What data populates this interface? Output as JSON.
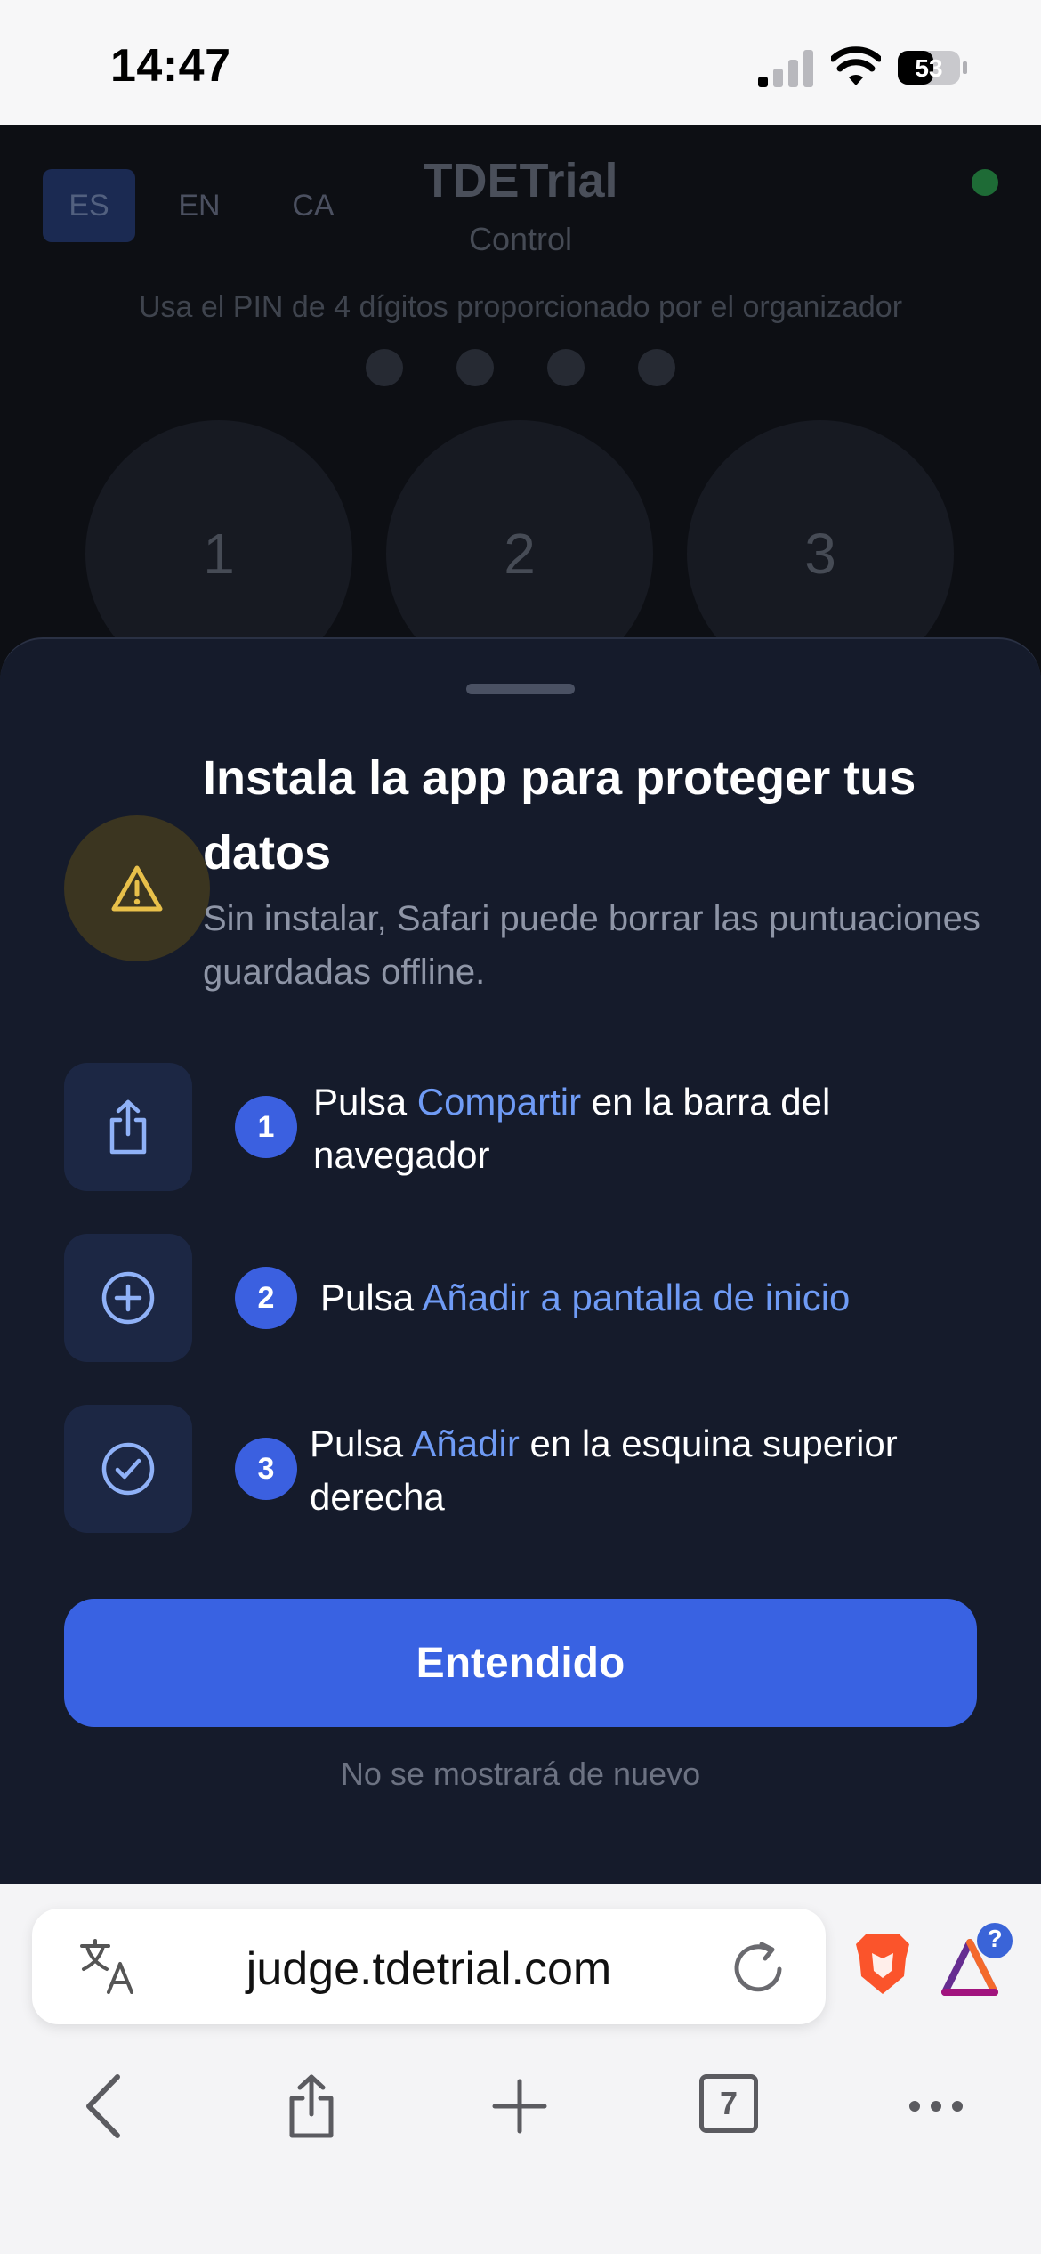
{
  "status_bar": {
    "time": "14:47",
    "battery": "53"
  },
  "app": {
    "languages": [
      "ES",
      "EN",
      "CA"
    ],
    "active_language": "ES",
    "title": "TDETrial",
    "subtitle": "Control",
    "pin_hint": "Usa el PIN de 4 dígitos proporcionado por el organizador",
    "keypad": [
      "1",
      "2",
      "3"
    ]
  },
  "sheet": {
    "title": "Instala la app para proteger tus datos",
    "description": "Sin instalar, Safari puede borrar las puntuaciones guardadas offline.",
    "steps": [
      {
        "number": "1",
        "icon": "share-icon",
        "prefix": "Pulsa ",
        "highlight": "Compartir",
        "suffix": " en la barra del navegador"
      },
      {
        "number": "2",
        "icon": "add-circle-icon",
        "prefix": "Pulsa ",
        "highlight": "Añadir a pantalla de inicio",
        "suffix": ""
      },
      {
        "number": "3",
        "icon": "check-circle-icon",
        "prefix": "Pulsa ",
        "highlight": "Añadir",
        "suffix": " en la esquina superior derecha"
      }
    ],
    "confirm_button": "Entendido",
    "note": "No se mostrará de nuevo"
  },
  "browser": {
    "url": "judge.tdetrial.com",
    "tab_count": "7",
    "rewards_badge": "?"
  },
  "colors": {
    "accent": "#3962e2",
    "highlight_text": "#6f9bf5",
    "sheet_bg": "#151b2b",
    "warning": "#e8c04a"
  }
}
